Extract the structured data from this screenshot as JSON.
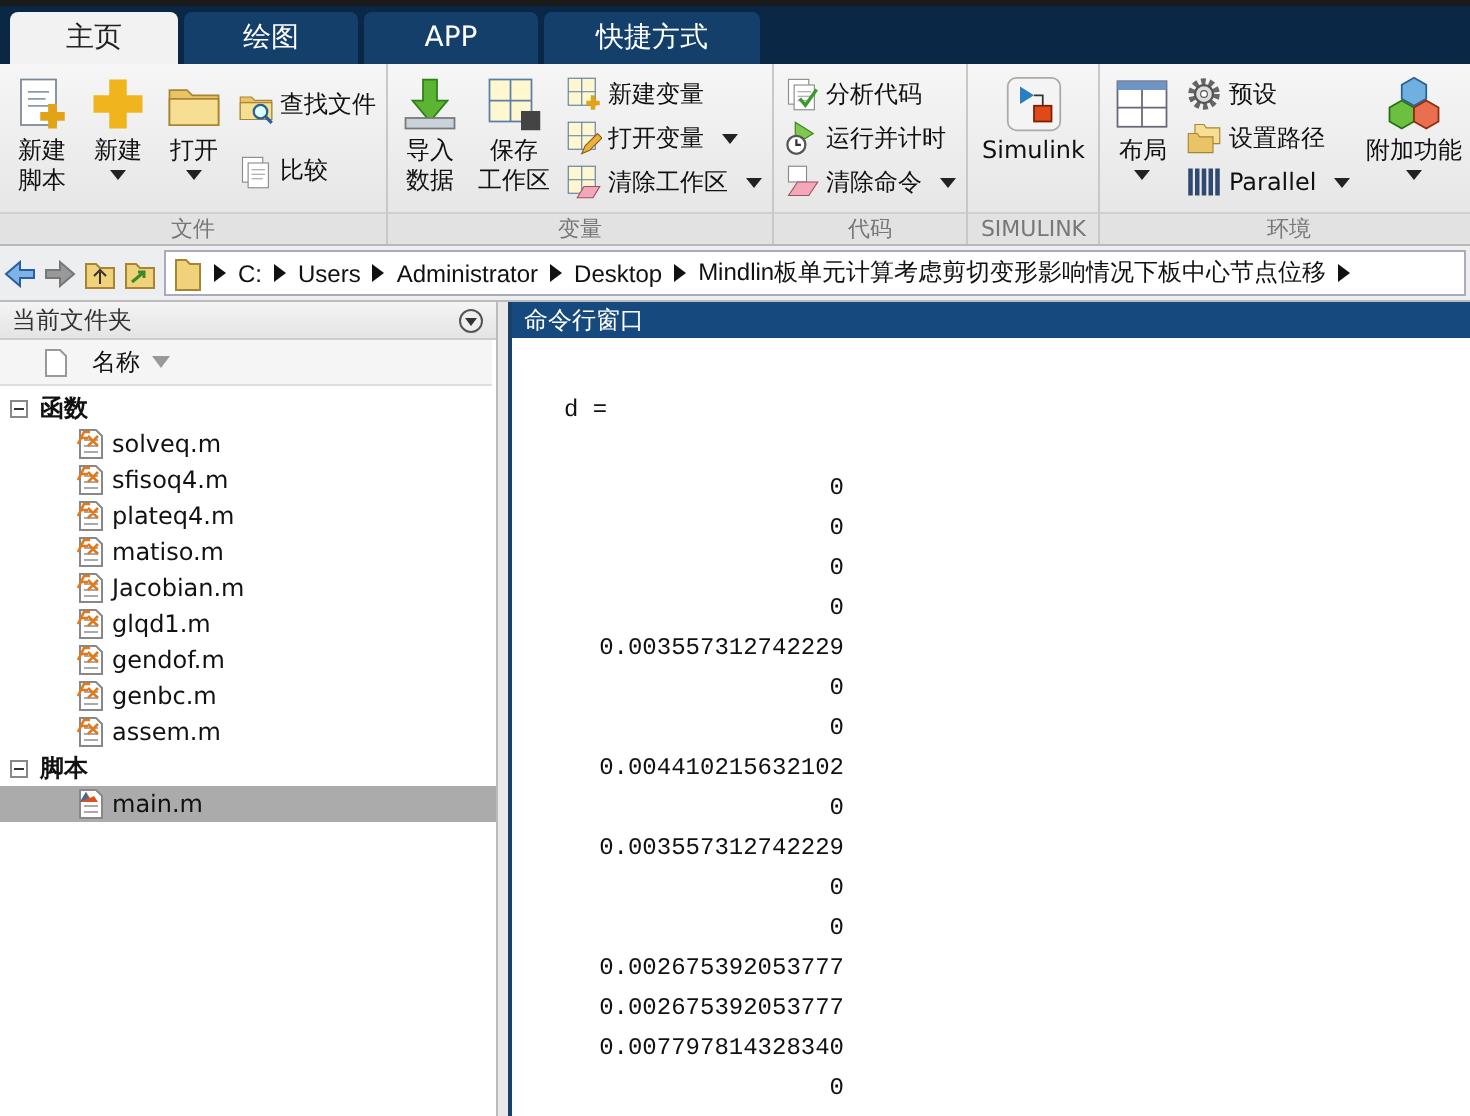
{
  "tabs": [
    {
      "label": "主页",
      "selected": true
    },
    {
      "label": "绘图",
      "selected": false
    },
    {
      "label": "APP",
      "selected": false
    },
    {
      "label": "快捷方式",
      "selected": false
    }
  ],
  "ribbon": {
    "groups": [
      {
        "title": "文件",
        "items": [
          {
            "kind": "large",
            "lines": [
              "新建",
              "脚本"
            ],
            "dropdown": false
          },
          {
            "kind": "large",
            "lines": [
              "新建"
            ],
            "dropdown": true
          },
          {
            "kind": "large",
            "lines": [
              "打开"
            ],
            "dropdown": true
          },
          {
            "kind": "stack",
            "items": [
              {
                "label": "查找文件",
                "dropdown": false
              },
              {
                "label": "比较",
                "dropdown": false
              }
            ]
          }
        ]
      },
      {
        "title": "变量",
        "items": [
          {
            "kind": "large",
            "lines": [
              "导入",
              "数据"
            ],
            "dropdown": false
          },
          {
            "kind": "large",
            "lines": [
              "保存",
              "工作区"
            ],
            "dropdown": false
          },
          {
            "kind": "stack",
            "items": [
              {
                "label": "新建变量",
                "dropdown": false
              },
              {
                "label": "打开变量",
                "dropdown": true
              },
              {
                "label": "清除工作区",
                "dropdown": true
              }
            ]
          }
        ]
      },
      {
        "title": "代码",
        "items": [
          {
            "kind": "stack",
            "items": [
              {
                "label": "分析代码",
                "dropdown": false
              },
              {
                "label": "运行并计时",
                "dropdown": false
              },
              {
                "label": "清除命令",
                "dropdown": true
              }
            ]
          }
        ]
      },
      {
        "title": "SIMULINK",
        "items": [
          {
            "kind": "large",
            "lines": [
              "Simulink"
            ],
            "dropdown": false
          }
        ]
      },
      {
        "title": "环境",
        "items": [
          {
            "kind": "large",
            "lines": [
              "布局"
            ],
            "dropdown": true
          },
          {
            "kind": "stack",
            "items": [
              {
                "label": "预设",
                "dropdown": false
              },
              {
                "label": "设置路径",
                "dropdown": false
              },
              {
                "label": "Parallel",
                "dropdown": true
              }
            ]
          },
          {
            "kind": "large",
            "lines": [
              "附加功能"
            ],
            "dropdown": true
          }
        ]
      }
    ]
  },
  "address_bar": {
    "path": [
      "C:",
      "Users",
      "Administrator",
      "Desktop",
      "Mindlin板单元计算考虑剪切变形影响情况下板中心节点位移"
    ]
  },
  "file_panel": {
    "title": "当前文件夹",
    "column": "名称",
    "sections": [
      {
        "label": "函数",
        "expanded": true,
        "children": [
          {
            "label": "solveq.m",
            "kind": "function",
            "selected": false
          },
          {
            "label": "sfisoq4.m",
            "kind": "function",
            "selected": false
          },
          {
            "label": "plateq4.m",
            "kind": "function",
            "selected": false
          },
          {
            "label": "matiso.m",
            "kind": "function",
            "selected": false
          },
          {
            "label": "Jacobian.m",
            "kind": "function",
            "selected": false
          },
          {
            "label": "glqd1.m",
            "kind": "function",
            "selected": false
          },
          {
            "label": "gendof.m",
            "kind": "function",
            "selected": false
          },
          {
            "label": "genbc.m",
            "kind": "function",
            "selected": false
          },
          {
            "label": "assem.m",
            "kind": "function",
            "selected": false
          }
        ]
      },
      {
        "label": "脚本",
        "expanded": true,
        "children": [
          {
            "label": "main.m",
            "kind": "script",
            "selected": true
          }
        ]
      }
    ]
  },
  "command_window": {
    "title": "命令行窗口",
    "variable": "d =",
    "values": [
      "0",
      "0",
      "0",
      "0",
      "0.003557312742229",
      "0",
      "0",
      "0.004410215632102",
      "0",
      "0.003557312742229",
      "0",
      "0",
      "0.002675392053777",
      "0.002675392053777",
      "0.007797814328340",
      "0"
    ]
  }
}
